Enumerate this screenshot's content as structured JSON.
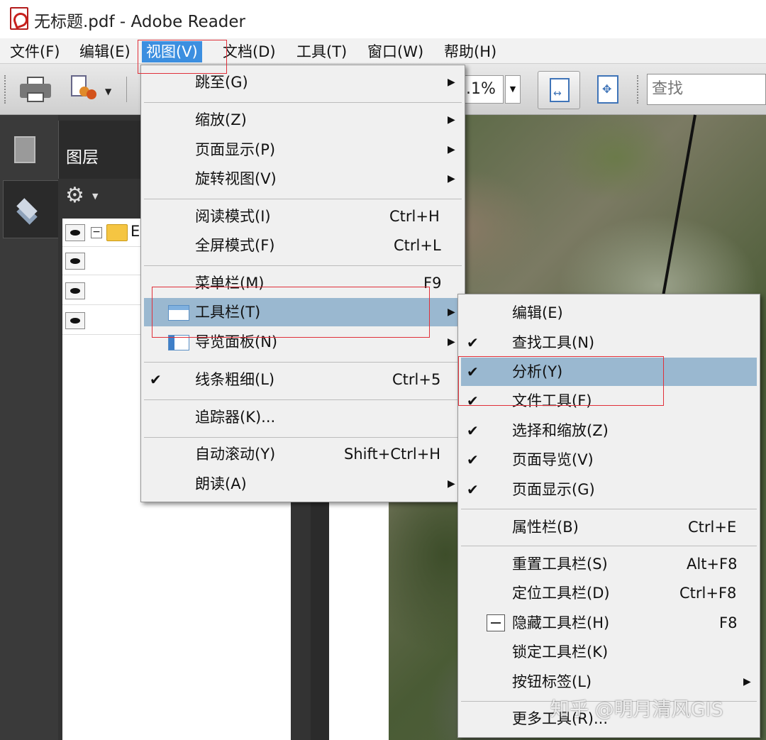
{
  "window": {
    "title": "无标题.pdf - Adobe Reader"
  },
  "menubar": {
    "items": [
      "文件(F)",
      "编辑(E)",
      "视图(V)",
      "文档(D)",
      "工具(T)",
      "窗口(W)",
      "帮助(H)"
    ],
    "active_index": 2
  },
  "toolbar": {
    "zoom_value": ".1%",
    "search_placeholder": "查找"
  },
  "left_panel": {
    "tab_label": "图层",
    "row_truncated_label": "E"
  },
  "view_menu": {
    "items": [
      {
        "label": "跳至(G)",
        "shortcut": "",
        "submenu": true
      },
      {
        "label": "缩放(Z)",
        "shortcut": "",
        "submenu": true
      },
      {
        "label": "页面显示(P)",
        "shortcut": "",
        "submenu": true
      },
      {
        "label": "旋转视图(V)",
        "shortcut": "",
        "submenu": true
      },
      {
        "label": "阅读模式(I)",
        "shortcut": "Ctrl+H",
        "submenu": false
      },
      {
        "label": "全屏模式(F)",
        "shortcut": "Ctrl+L",
        "submenu": false
      },
      {
        "label": "菜单栏(M)",
        "shortcut": "F9",
        "submenu": false
      },
      {
        "label": "工具栏(T)",
        "shortcut": "",
        "submenu": true,
        "highlighted": true
      },
      {
        "label": "导览面板(N)",
        "shortcut": "",
        "submenu": true
      },
      {
        "label": "线条粗细(L)",
        "shortcut": "Ctrl+5",
        "submenu": false,
        "checked": true
      },
      {
        "label": "追踪器(K)...",
        "shortcut": "",
        "submenu": false
      },
      {
        "label": "自动滚动(Y)",
        "shortcut": "Shift+Ctrl+H",
        "submenu": false
      },
      {
        "label": "朗读(A)",
        "shortcut": "",
        "submenu": true
      }
    ]
  },
  "toolbars_submenu": {
    "items": [
      {
        "label": "编辑(E)",
        "shortcut": "",
        "checked": false
      },
      {
        "label": "查找工具(N)",
        "shortcut": "",
        "checked": true
      },
      {
        "label": "分析(Y)",
        "shortcut": "",
        "checked": true,
        "highlighted": true
      },
      {
        "label": "文件工具(F)",
        "shortcut": "",
        "checked": true
      },
      {
        "label": "选择和缩放(Z)",
        "shortcut": "",
        "checked": true
      },
      {
        "label": "页面导览(V)",
        "shortcut": "",
        "checked": true
      },
      {
        "label": "页面显示(G)",
        "shortcut": "",
        "checked": true
      },
      {
        "label": "属性栏(B)",
        "shortcut": "Ctrl+E",
        "checked": false
      },
      {
        "label": "重置工具栏(S)",
        "shortcut": "Alt+F8",
        "checked": false
      },
      {
        "label": "定位工具栏(D)",
        "shortcut": "Ctrl+F8",
        "checked": false
      },
      {
        "label": "隐藏工具栏(H)",
        "shortcut": "F8",
        "checked": false
      },
      {
        "label": "锁定工具栏(K)",
        "shortcut": "",
        "checked": false
      },
      {
        "label": "按钮标签(L)",
        "shortcut": "",
        "checked": false,
        "submenu": true
      },
      {
        "label": "更多工具(R)...",
        "shortcut": "",
        "checked": false
      }
    ]
  },
  "glyphs": {
    "check": "✔",
    "arrow": "▶",
    "caret": "▼",
    "gear": "⚙"
  },
  "watermark": "知乎 @明月清风GIS",
  "colors": {
    "menu_highlight": "#9ab8d0",
    "menubar_active": "#3c8fe0",
    "annotation_red": "#e0303a"
  }
}
